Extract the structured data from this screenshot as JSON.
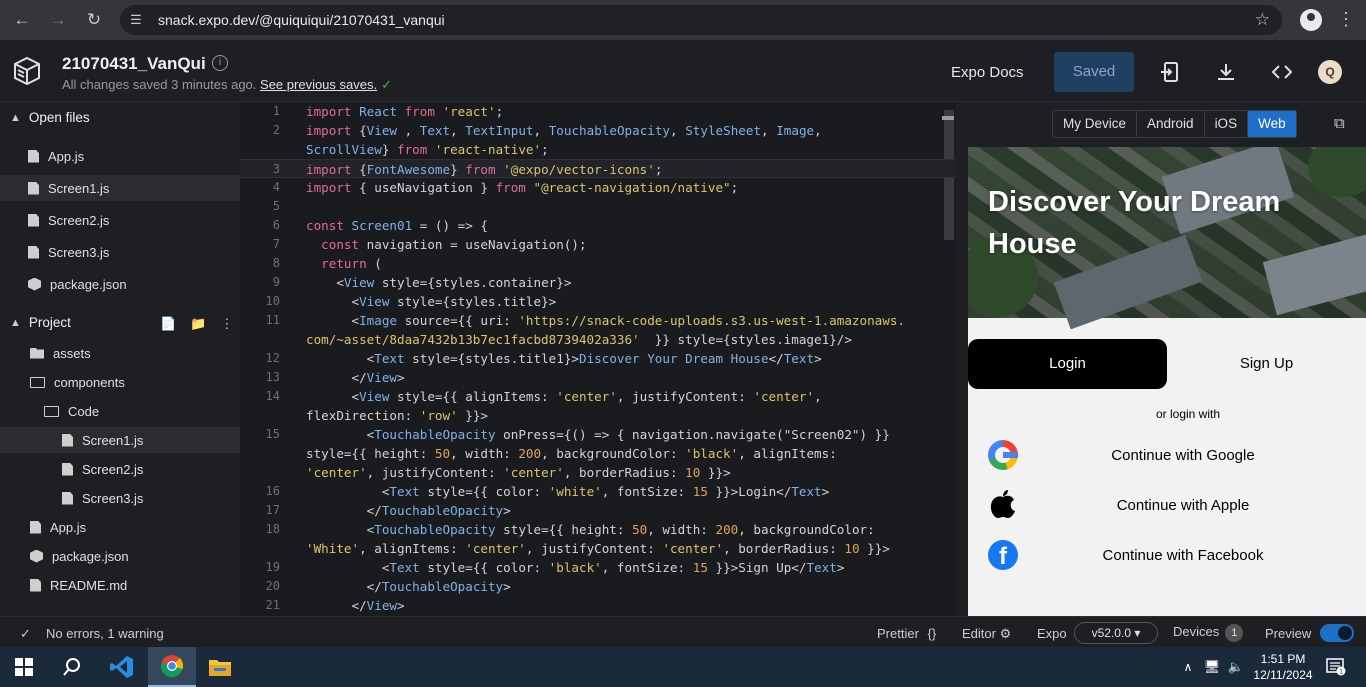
{
  "browser": {
    "url": "snack.expo.dev/@quiquiqui/21070431_vanqui"
  },
  "header": {
    "project_title": "21070431_VanQui",
    "save_status": "All changes saved 3 minutes ago.",
    "previous_saves_link": "See previous saves.",
    "docs_label": "Expo Docs",
    "saved_label": "Saved",
    "avatar_initial": "Q"
  },
  "sidebar": {
    "open_files_label": "Open files",
    "open_files": [
      "App.js",
      "Screen1.js",
      "Screen2.js",
      "Screen3.js",
      "package.json"
    ],
    "project_label": "Project",
    "project_tree": [
      {
        "name": "assets",
        "type": "folder"
      },
      {
        "name": "components",
        "type": "folder-open"
      },
      {
        "name": "Code",
        "type": "folder-open"
      },
      {
        "name": "Screen1.js",
        "type": "file"
      },
      {
        "name": "Screen2.js",
        "type": "file"
      },
      {
        "name": "Screen3.js",
        "type": "file"
      },
      {
        "name": "App.js",
        "type": "file"
      },
      {
        "name": "package.json",
        "type": "package"
      },
      {
        "name": "README.md",
        "type": "file"
      }
    ]
  },
  "editor": {
    "lines": [
      {
        "n": "1",
        "tokens": [
          [
            "kw",
            "import "
          ],
          [
            "id",
            "React "
          ],
          [
            "kw",
            "from "
          ],
          [
            "str",
            "'react'"
          ],
          [
            "",
            "; "
          ]
        ]
      },
      {
        "n": "2",
        "tokens": [
          [
            "kw",
            "import "
          ],
          [
            "",
            "{"
          ],
          [
            "id",
            "View"
          ],
          [
            "",
            " , "
          ],
          [
            "id",
            "Text"
          ],
          [
            "",
            ", "
          ],
          [
            "id",
            "TextInput"
          ],
          [
            "",
            ", "
          ],
          [
            "id",
            "TouchableOpacity"
          ],
          [
            "",
            ", "
          ],
          [
            "id",
            "StyleSheet"
          ],
          [
            "",
            ", "
          ],
          [
            "id",
            "Image"
          ],
          [
            "",
            ","
          ]
        ]
      },
      {
        "n": "",
        "tokens": [
          [
            "id",
            "ScrollView"
          ],
          [
            "",
            "} "
          ],
          [
            "kw",
            "from "
          ],
          [
            "str",
            "'react-native'"
          ],
          [
            "",
            ";"
          ]
        ]
      },
      {
        "n": "3",
        "tokens": [
          [
            "kw",
            "import "
          ],
          [
            "",
            "{"
          ],
          [
            "id",
            "FontAwesome"
          ],
          [
            "",
            "} "
          ],
          [
            "kw",
            "from "
          ],
          [
            "str",
            "'@expo/vector-icons'"
          ],
          [
            "",
            ";"
          ]
        ],
        "current": true
      },
      {
        "n": "4",
        "tokens": [
          [
            "kw",
            "import "
          ],
          [
            "",
            "{ useNavigation } "
          ],
          [
            "kw",
            "from "
          ],
          [
            "str",
            "\"@react-navigation/native\""
          ],
          [
            "",
            ";"
          ]
        ]
      },
      {
        "n": "5",
        "tokens": []
      },
      {
        "n": "6",
        "tokens": [
          [
            "kw",
            "const "
          ],
          [
            "id",
            "Screen01 "
          ],
          [
            "",
            "= () => {"
          ]
        ]
      },
      {
        "n": "7",
        "tokens": [
          [
            "",
            "  "
          ],
          [
            "kw",
            "const "
          ],
          [
            "",
            "navigation = useNavigation();"
          ]
        ]
      },
      {
        "n": "8",
        "tokens": [
          [
            "",
            "  "
          ],
          [
            "kw",
            "return "
          ],
          [
            "",
            "("
          ]
        ]
      },
      {
        "n": "9",
        "tokens": [
          [
            "",
            "    <"
          ],
          [
            "tag",
            "View "
          ],
          [
            "",
            "style={styles.container}>"
          ]
        ]
      },
      {
        "n": "10",
        "tokens": [
          [
            "",
            "      <"
          ],
          [
            "tag",
            "View "
          ],
          [
            "",
            "style={styles.title}>"
          ]
        ]
      },
      {
        "n": "11",
        "tokens": [
          [
            "",
            "      <"
          ],
          [
            "tag",
            "Image "
          ],
          [
            "",
            "source={{ uri: "
          ],
          [
            "str",
            "'https://snack-code-uploads.s3.us-west-1.amazonaws."
          ]
        ]
      },
      {
        "n": "",
        "tokens": [
          [
            "str",
            "com/~asset/8daa7432b13b7ec1facbd8739402a336'"
          ],
          [
            "",
            "  }} style={styles.image1}/>"
          ]
        ]
      },
      {
        "n": "12",
        "tokens": [
          [
            "",
            "        <"
          ],
          [
            "tag",
            "Text "
          ],
          [
            "",
            "style={styles.title1}>"
          ],
          [
            "id",
            "Discover Your Dream House"
          ],
          [
            "",
            "</"
          ],
          [
            "tag",
            "Text"
          ],
          [
            "",
            ">"
          ]
        ]
      },
      {
        "n": "13",
        "tokens": [
          [
            "",
            "      </"
          ],
          [
            "tag",
            "View"
          ],
          [
            "",
            ">"
          ]
        ]
      },
      {
        "n": "14",
        "tokens": [
          [
            "",
            "      <"
          ],
          [
            "tag",
            "View "
          ],
          [
            "",
            "style={{ alignItems: "
          ],
          [
            "str",
            "'center'"
          ],
          [
            "",
            ", justifyContent: "
          ],
          [
            "str",
            "'center'"
          ],
          [
            "",
            ","
          ]
        ]
      },
      {
        "n": "",
        "tokens": [
          [
            "",
            "flexDirection: "
          ],
          [
            "str",
            "'row'"
          ],
          [
            "",
            " }}>"
          ]
        ]
      },
      {
        "n": "15",
        "tokens": [
          [
            "",
            "        <"
          ],
          [
            "tag",
            "TouchableOpacity "
          ],
          [
            "",
            "onPress={() => { navigation.navigate(\"Screen02\") }}"
          ]
        ]
      },
      {
        "n": "",
        "tokens": [
          [
            "",
            "style={{ height: "
          ],
          [
            "num",
            "50"
          ],
          [
            "",
            ", width: "
          ],
          [
            "num",
            "200"
          ],
          [
            "",
            ", backgroundColor: "
          ],
          [
            "str",
            "'black'"
          ],
          [
            "",
            ", alignItems:"
          ]
        ]
      },
      {
        "n": "",
        "tokens": [
          [
            "str",
            "'center'"
          ],
          [
            "",
            ", justifyContent: "
          ],
          [
            "str",
            "'center'"
          ],
          [
            "",
            ", borderRadius: "
          ],
          [
            "num",
            "10"
          ],
          [
            "",
            " }}>"
          ]
        ]
      },
      {
        "n": "16",
        "tokens": [
          [
            "",
            "          <"
          ],
          [
            "tag",
            "Text "
          ],
          [
            "",
            "style={{ color: "
          ],
          [
            "str",
            "'white'"
          ],
          [
            "",
            ", fontSize: "
          ],
          [
            "num",
            "15"
          ],
          [
            "",
            " }}>Login</"
          ],
          [
            "tag",
            "Text"
          ],
          [
            "",
            ">"
          ]
        ]
      },
      {
        "n": "17",
        "tokens": [
          [
            "",
            "        </"
          ],
          [
            "tag",
            "TouchableOpacity"
          ],
          [
            "",
            ">"
          ]
        ]
      },
      {
        "n": "18",
        "tokens": [
          [
            "",
            "        <"
          ],
          [
            "tag",
            "TouchableOpacity "
          ],
          [
            "",
            "style={{ height: "
          ],
          [
            "num",
            "50"
          ],
          [
            "",
            ", width: "
          ],
          [
            "num",
            "200"
          ],
          [
            "",
            ", backgroundColor:"
          ]
        ]
      },
      {
        "n": "",
        "tokens": [
          [
            "str",
            "'White'"
          ],
          [
            "",
            ", alignItems: "
          ],
          [
            "str",
            "'center'"
          ],
          [
            "",
            ", justifyContent: "
          ],
          [
            "str",
            "'center'"
          ],
          [
            "",
            ", borderRadius: "
          ],
          [
            "num",
            "10"
          ],
          [
            "",
            " }}>"
          ]
        ]
      },
      {
        "n": "19",
        "tokens": [
          [
            "",
            "          <"
          ],
          [
            "tag",
            "Text "
          ],
          [
            "",
            "style={{ color: "
          ],
          [
            "str",
            "'black'"
          ],
          [
            "",
            ", fontSize: "
          ],
          [
            "num",
            "15"
          ],
          [
            "",
            " }}>Sign Up</"
          ],
          [
            "tag",
            "Text"
          ],
          [
            "",
            ">"
          ]
        ]
      },
      {
        "n": "20",
        "tokens": [
          [
            "",
            "        </"
          ],
          [
            "tag",
            "TouchableOpacity"
          ],
          [
            "",
            ">"
          ]
        ]
      },
      {
        "n": "21",
        "tokens": [
          [
            "",
            "      </"
          ],
          [
            "tag",
            "View"
          ],
          [
            "",
            ">"
          ]
        ]
      }
    ]
  },
  "preview": {
    "tabs": [
      "My Device",
      "Android",
      "iOS",
      "Web"
    ],
    "active_tab": "Web",
    "hero_title": "Discover Your Dream House",
    "login_label": "Login",
    "signup_label": "Sign Up",
    "or_label": "or login with",
    "socials": [
      {
        "icon": "google-icon",
        "label": "Continue with Google"
      },
      {
        "icon": "apple-icon",
        "label": "Continue with Apple"
      },
      {
        "icon": "facebook-icon",
        "label": "Continue with Facebook"
      }
    ]
  },
  "status": {
    "problems": "No errors, 1 warning",
    "prettier": "Prettier",
    "editor": "Editor",
    "expo": "Expo",
    "version": "v52.0.0",
    "devices": "Devices",
    "devices_count": "1",
    "preview": "Preview",
    "preview_on": true
  },
  "taskbar": {
    "time": "1:51 PM",
    "date": "12/11/2024",
    "notification_count": "1"
  },
  "colors": {
    "accent": "#1f6fc9",
    "background": "#1e1f22"
  }
}
